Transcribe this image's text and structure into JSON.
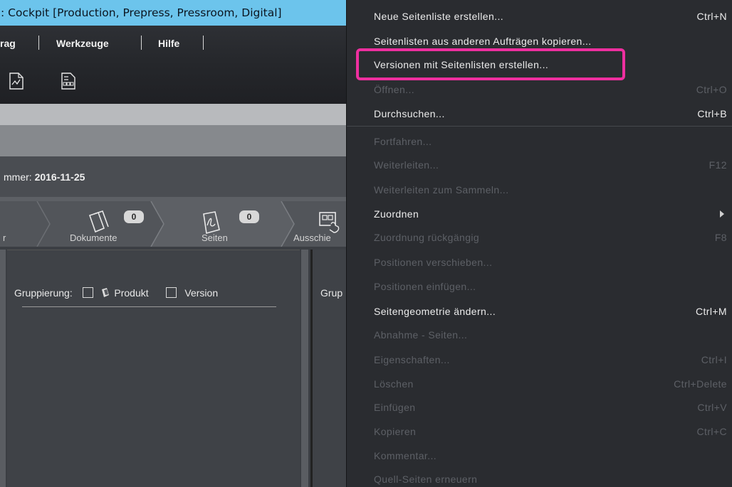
{
  "window": {
    "title": ": Cockpit [Production, Prepress, Pressroom, Digital]"
  },
  "menubar": {
    "items": [
      "rag",
      "Werkzeuge",
      "Hilfe"
    ]
  },
  "job": {
    "number_label": "mmer:",
    "number_value": "2016-11-25"
  },
  "steps": [
    {
      "label": "r",
      "icon": "chevron-step-icon"
    },
    {
      "label": "Dokumente",
      "badge": "0",
      "icon": "documents-icon"
    },
    {
      "label": "Seiten",
      "badge": "0",
      "icon": "pdf-page-icon"
    },
    {
      "label": "Ausschie",
      "icon": "imposition-hand-icon"
    }
  ],
  "grouping": {
    "label": "Gruppierung:",
    "option1": "Produkt",
    "option2": "Version",
    "right_label": "Grup"
  },
  "context_menu": {
    "items": [
      {
        "label": "Neue Seitenliste erstellen...",
        "shortcut": "Ctrl+N",
        "enabled": true
      },
      {
        "label": "Seitenlisten aus anderen Aufträgen kopieren...",
        "shortcut": "",
        "enabled": true
      },
      {
        "label": "Versionen mit Seitenlisten erstellen...",
        "shortcut": "",
        "enabled": true
      },
      {
        "label": "Öffnen...",
        "shortcut": "Ctrl+O",
        "enabled": false
      },
      {
        "label": "Durchsuchen...",
        "shortcut": "Ctrl+B",
        "enabled": true
      },
      {
        "label": "Fortfahren...",
        "shortcut": "",
        "enabled": false
      },
      {
        "label": "Weiterleiten...",
        "shortcut": "F12",
        "enabled": false
      },
      {
        "label": "Weiterleiten zum Sammeln...",
        "shortcut": "",
        "enabled": false
      },
      {
        "label": "Zuordnen",
        "shortcut": "",
        "enabled": true,
        "submenu": true
      },
      {
        "label": "Zuordnung rückgängig",
        "shortcut": "F8",
        "enabled": false
      },
      {
        "label": "Positionen verschieben...",
        "shortcut": "",
        "enabled": false
      },
      {
        "label": "Positionen einfügen...",
        "shortcut": "",
        "enabled": false
      },
      {
        "label": "Seitengeometrie ändern...",
        "shortcut": "Ctrl+M",
        "enabled": true
      },
      {
        "label": "Abnahme - Seiten...",
        "shortcut": "",
        "enabled": false
      },
      {
        "label": "Eigenschaften...",
        "shortcut": "Ctrl+I",
        "enabled": false
      },
      {
        "label": "Löschen",
        "shortcut": "Ctrl+Delete",
        "enabled": false
      },
      {
        "label": "Einfügen",
        "shortcut": "Ctrl+V",
        "enabled": false
      },
      {
        "label": "Kopieren",
        "shortcut": "Ctrl+C",
        "enabled": false
      },
      {
        "label": "Kommentar...",
        "shortcut": "",
        "enabled": false
      },
      {
        "label": "Quell-Seiten erneuern",
        "shortcut": "",
        "enabled": false
      }
    ]
  },
  "colors": {
    "titlebar": "#6cc4ec",
    "highlight": "#ee2f9f",
    "menu_bg": "#2a2c30"
  }
}
